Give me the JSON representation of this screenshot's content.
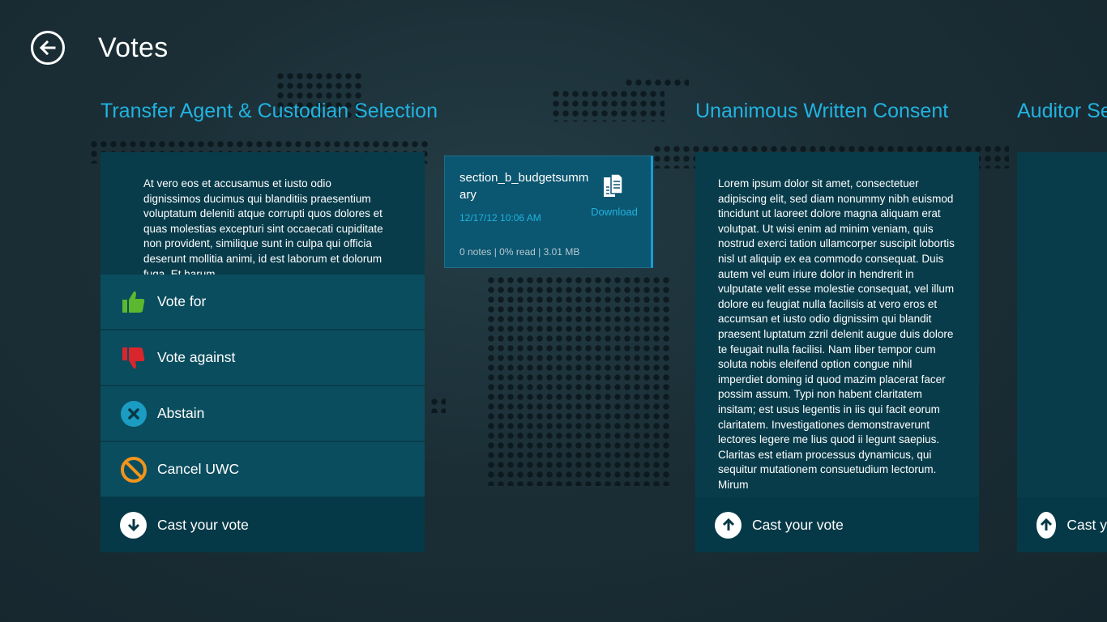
{
  "header": {
    "title": "Votes",
    "back_icon": "back-arrow-icon"
  },
  "columns": [
    {
      "title": "Transfer Agent & Custodian Selection",
      "description": "At vero eos et accusamus et iusto odio dignissimos ducimus qui blanditiis praesentium voluptatum deleniti atque corrupti quos dolores et quas molestias excepturi sint occaecati cupiditate non provident, similique sunt in culpa qui officia deserunt mollitia animi, id est laborum et dolorum fuga. Et harum",
      "options": [
        {
          "label": "Vote for",
          "icon": "thumbs-up-icon",
          "color": "#5cb82e"
        },
        {
          "label": "Vote against",
          "icon": "thumbs-down-icon",
          "color": "#d9262c"
        },
        {
          "label": "Abstain",
          "icon": "abstain-x-icon",
          "color": "#1b9cc2"
        },
        {
          "label": "Cancel UWC",
          "icon": "cancel-prohibited-icon",
          "color": "#f0941c"
        }
      ],
      "cast_label": "Cast your vote"
    },
    {
      "title": "Unanimous Written Consent",
      "description": "Lorem ipsum dolor sit amet, consectetuer adipiscing elit, sed diam nonummy nibh euismod tincidunt ut laoreet dolore magna aliquam erat volutpat. Ut wisi enim ad minim veniam, quis nostrud exerci tation ullamcorper suscipit lobortis nisl ut aliquip ex ea commodo consequat. Duis autem vel eum iriure dolor in hendrerit in vulputate velit esse molestie consequat, vel illum dolore eu feugiat nulla facilisis at vero eros et accumsan et iusto odio dignissim qui blandit praesent luptatum zzril delenit augue duis dolore te feugait nulla facilisi. Nam liber tempor cum soluta nobis eleifend option congue nihil imperdiet doming id quod mazim placerat facer possim assum. Typi non habent claritatem insitam; est usus legentis in iis qui facit eorum claritatem. Investigationes demonstraverunt lectores legere me lius quod ii legunt saepius. Claritas est etiam processus dynamicus, qui sequitur mutationem consuetudium lectorum. Mirum",
      "cast_label": "Cast your vote"
    },
    {
      "title": "Auditor Se",
      "cast_label": "Cast y"
    }
  ],
  "document": {
    "name": "section_b_budgetsummary",
    "date": "12/17/12 10:06 AM",
    "meta": "0 notes | 0% read | 3.01 MB",
    "download_label": "Download",
    "icon": "document-icon"
  },
  "colors": {
    "accent": "#21b3e0",
    "panel": "#083c4b",
    "row": "#0a4d5e"
  }
}
